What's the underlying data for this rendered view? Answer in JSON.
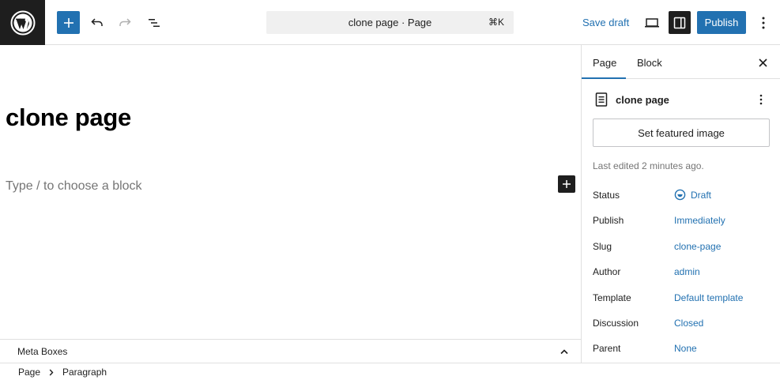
{
  "topbar": {
    "command_title": "clone page · Page",
    "command_shortcut": "⌘K",
    "save_draft_label": "Save draft",
    "publish_label": "Publish",
    "accent_color": "#2271b1"
  },
  "editor": {
    "post_title": "clone page",
    "block_placeholder": "Type / to choose a block"
  },
  "metabox": {
    "label": "Meta Boxes"
  },
  "breadcrumb": {
    "items": [
      "Page",
      "Paragraph"
    ]
  },
  "sidebar": {
    "tabs": [
      "Page",
      "Block"
    ],
    "active_tab": "Page",
    "document_title": "clone page",
    "featured_image_label": "Set featured image",
    "last_edited": "Last edited 2 minutes ago.",
    "properties": [
      {
        "label": "Status",
        "value": "Draft"
      },
      {
        "label": "Publish",
        "value": "Immediately"
      },
      {
        "label": "Slug",
        "value": "clone-page"
      },
      {
        "label": "Author",
        "value": "admin"
      },
      {
        "label": "Template",
        "value": "Default template"
      },
      {
        "label": "Discussion",
        "value": "Closed"
      },
      {
        "label": "Parent",
        "value": "None"
      }
    ]
  }
}
